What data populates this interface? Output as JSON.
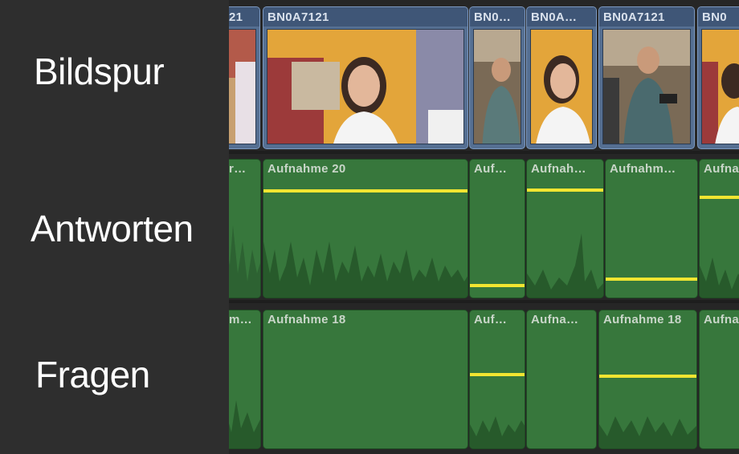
{
  "tracks": {
    "video_label": "Bildspur",
    "answers_label": "Antworten",
    "questions_label": "Fragen"
  },
  "video_clips": [
    {
      "name": "21"
    },
    {
      "name": "BN0A7121"
    },
    {
      "name": "BN0…"
    },
    {
      "name": "BN0A…"
    },
    {
      "name": "BN0A7121"
    },
    {
      "name": "BN0"
    }
  ],
  "answer_clips": [
    {
      "name": "r…"
    },
    {
      "name": "Aufnahme 20"
    },
    {
      "name": "Auf…"
    },
    {
      "name": "Aufnah…"
    },
    {
      "name": "Aufnahm…"
    },
    {
      "name": "Aufna"
    }
  ],
  "question_clips": [
    {
      "name": "m…"
    },
    {
      "name": "Aufnahme 18"
    },
    {
      "name": "Auf…"
    },
    {
      "name": "Aufna…"
    },
    {
      "name": "Aufnahme 18"
    },
    {
      "name": "Aufna"
    }
  ],
  "colors": {
    "video_clip": "#556f92",
    "audio_clip": "#37773c",
    "volume_line": "#f2e531"
  }
}
